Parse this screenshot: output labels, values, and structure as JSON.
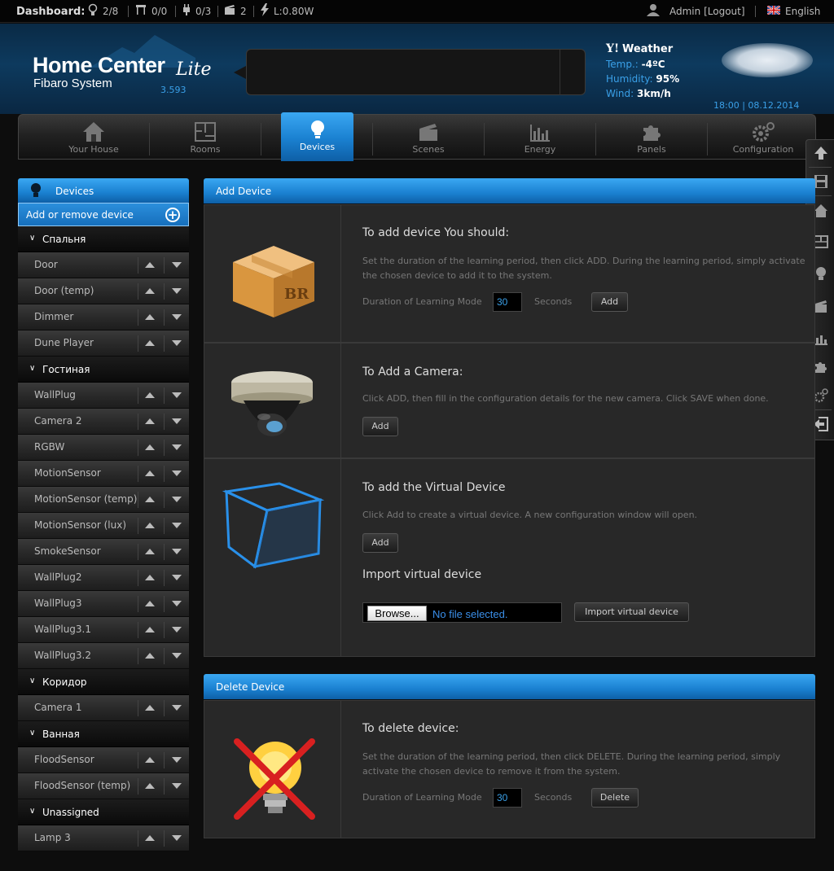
{
  "topbar": {
    "dashboard_label": "Dashboard:",
    "lights": "2/8",
    "blinds": "0/0",
    "plugs": "0/3",
    "scenes": "2",
    "power": "L:0.80W",
    "user": "Admin",
    "logout": "[Logout]",
    "language": "English"
  },
  "header": {
    "logo_main": "Home Center",
    "logo_lite": "Lite",
    "logo_sub": "Fibaro System",
    "version": "3.593",
    "weather_title": "Weather",
    "temp_label": "Temp.:",
    "temp_value": "-4ºC",
    "humidity_label": "Humidity:",
    "humidity_value": "95%",
    "wind_label": "Wind:",
    "wind_value": "3km/h",
    "datetime": "18:00 | 08.12.2014"
  },
  "nav": [
    {
      "label": "Your House",
      "icon": "house-icon"
    },
    {
      "label": "Rooms",
      "icon": "rooms-icon"
    },
    {
      "label": "Devices",
      "icon": "bulb-icon"
    },
    {
      "label": "Scenes",
      "icon": "clapper-icon"
    },
    {
      "label": "Energy",
      "icon": "chart-icon"
    },
    {
      "label": "Panels",
      "icon": "puzzle-icon"
    },
    {
      "label": "Configuration",
      "icon": "gears-icon"
    }
  ],
  "sidebar": {
    "title": "Devices",
    "add_remove": "Add or remove device",
    "rooms": [
      {
        "name": "Спальня",
        "devices": [
          "Door",
          "Door (temp)",
          "Dimmer",
          "Dune Player"
        ]
      },
      {
        "name": "Гостиная",
        "devices": [
          "WallPlug",
          "Camera 2",
          "RGBW",
          "MotionSensor",
          "MotionSensor (temp)",
          "MotionSensor (lux)",
          "SmokeSensor",
          "WallPlug2",
          "WallPlug3",
          "WallPlug3.1",
          "WallPlug3.2"
        ]
      },
      {
        "name": "Коридор",
        "devices": [
          "Camera 1"
        ]
      },
      {
        "name": "Ванная",
        "devices": [
          "FloodSensor",
          "FloodSensor (temp)"
        ]
      },
      {
        "name": "Unassigned",
        "devices": [
          "Lamp 3"
        ]
      }
    ]
  },
  "add_device": {
    "title": "Add Device",
    "s1_title": "To add device You should:",
    "s1_text": "Set the duration of the learning period, then click ADD. During the learning period, simply activate the chosen device to add it to the system.",
    "duration_label": "Duration of Learning Mode",
    "duration_value": "30",
    "seconds_label": "Seconds",
    "add_label": "Add",
    "s2_title": "To Add a Camera:",
    "s2_text": "Click ADD, then fill in the configuration details for the new camera. Click SAVE when done.",
    "s3_title": "To add the Virtual Device",
    "s3_text": "Click Add to create a virtual device. A new configuration window will open.",
    "import_title": "Import virtual device",
    "browse_label": "Browse...",
    "no_file": "No file selected.",
    "import_button": "Import virtual device"
  },
  "delete_device": {
    "title": "Delete Device",
    "s_title": "To delete device:",
    "s_text": "Set the duration of the learning period, then click DELETE. During the learning period, simply activate the chosen device to remove it from the system.",
    "duration_label": "Duration of Learning Mode",
    "duration_value": "30",
    "seconds_label": "Seconds",
    "delete_label": "Delete"
  }
}
